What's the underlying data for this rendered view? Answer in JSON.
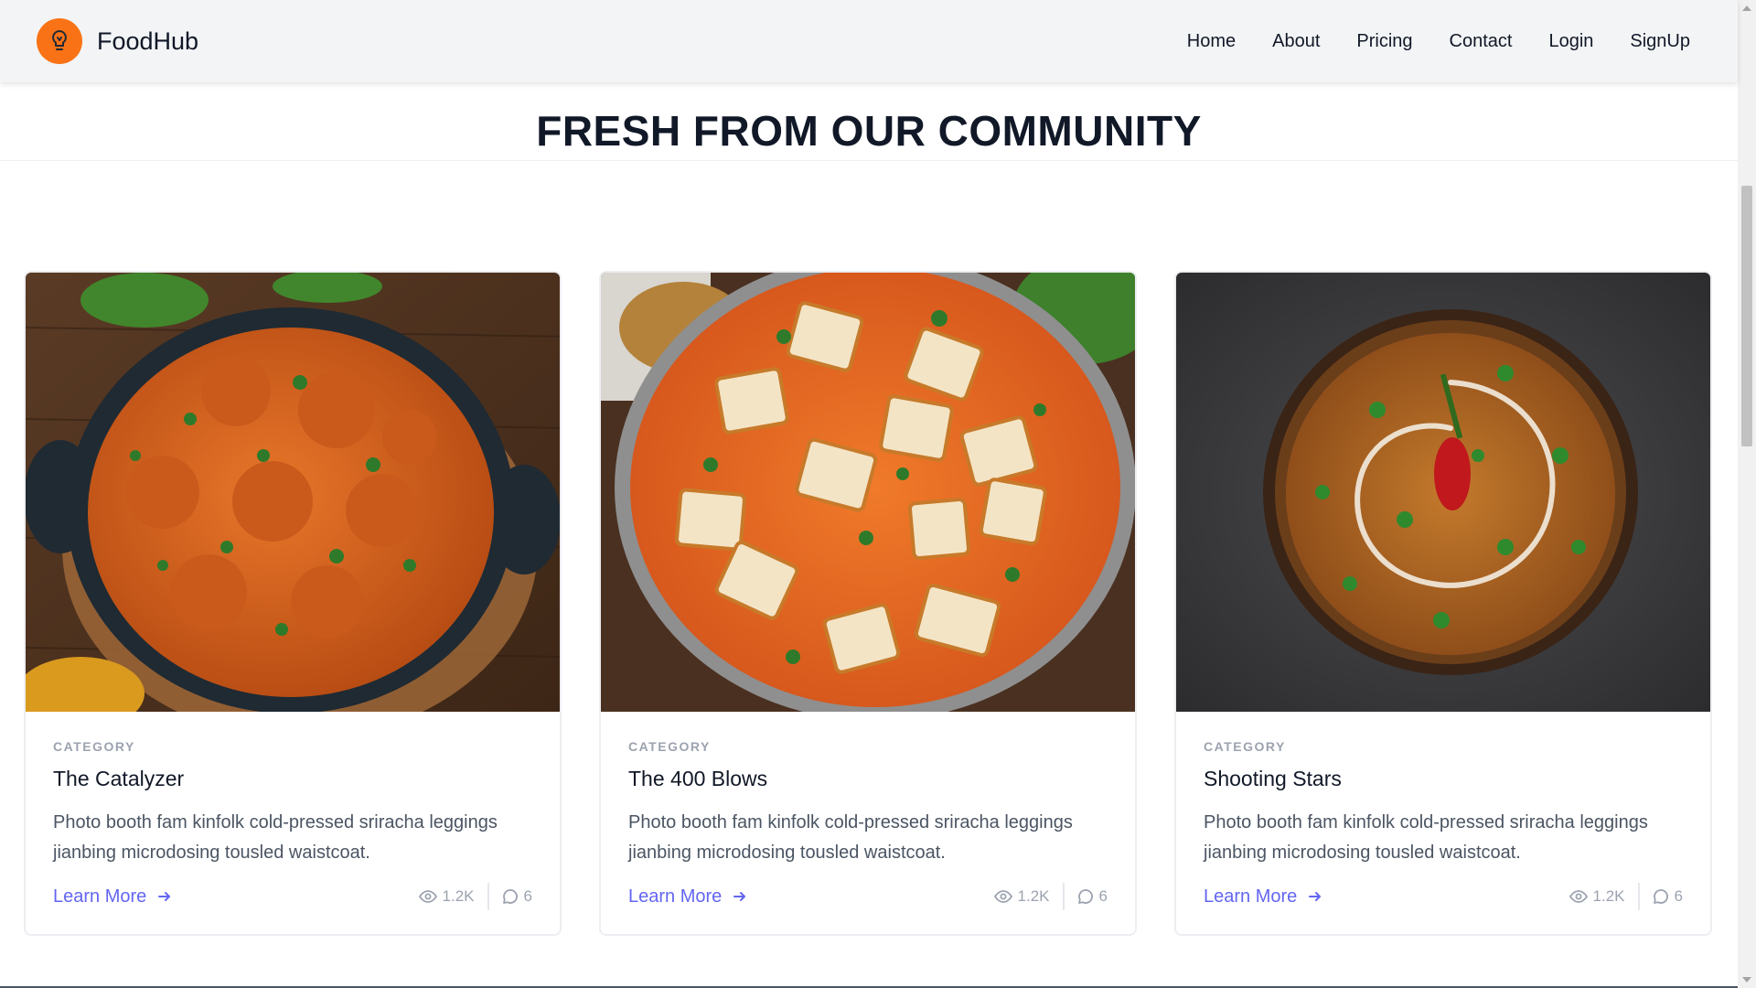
{
  "header": {
    "brand_name": "FoodHub",
    "logo_icon": "lightbulb-icon",
    "nav": [
      "Home",
      "About",
      "Pricing",
      "Contact",
      "Login",
      "SignUp"
    ]
  },
  "section": {
    "title": "FRESH FROM OUR COMMUNITY"
  },
  "cards": [
    {
      "category": "CATEGORY",
      "title": "The Catalyzer",
      "description": "Photo booth fam kinfolk cold-pressed sriracha leggings jianbing microdosing tousled waistcoat.",
      "link_label": "Learn More",
      "views": "1.2K",
      "comments": "6",
      "image": "butter chicken dish"
    },
    {
      "category": "CATEGORY",
      "title": "The 400 Blows",
      "description": "Photo booth fam kinfolk cold-pressed sriracha leggings jianbing microdosing tousled waistcoat.",
      "link_label": "Learn More",
      "views": "1.2K",
      "comments": "6",
      "image": "paneer curry dish"
    },
    {
      "category": "CATEGORY",
      "title": "Shooting Stars",
      "description": "Photo booth fam kinfolk cold-pressed sriracha leggings jianbing microdosing tousled waistcoat.",
      "link_label": "Learn More",
      "views": "1.2K",
      "comments": "6",
      "image": "dal makhani bowl"
    }
  ],
  "colors": {
    "accent": "#6366f1",
    "brand": "#f97316",
    "header_bg": "#f3f4f6"
  }
}
